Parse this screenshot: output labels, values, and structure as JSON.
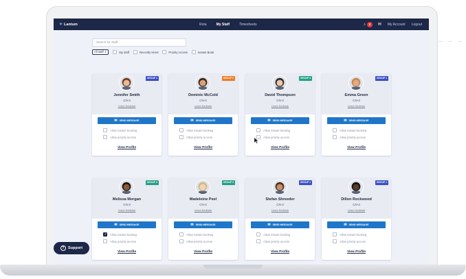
{
  "nav": {
    "logo": "Lantum",
    "links": [
      "Rota",
      "My Staff",
      "Timesheets"
    ],
    "notifications_count": "3",
    "my_account": "My Account",
    "logout": "Logout"
  },
  "search": {
    "placeholder": "Search for Staff"
  },
  "filters": {
    "selected": "All staff",
    "options": [
      "My staff",
      "Recently Hired",
      "Priority Access",
      "Instant Book"
    ]
  },
  "card_labels": {
    "leave_feedback": "Leave feedback",
    "send_message": "SEND MESSAGE",
    "allow_instant": "Allow instant booking",
    "allow_priority": "Allow priority access",
    "view_profile": "View Profile"
  },
  "staff": [
    {
      "name": "Jennifer Smith",
      "grade": "CN-3",
      "group": "GROUP 1",
      "group_color": "#3b4fc4",
      "instant_checked": false
    },
    {
      "name": "Dominic McCold",
      "grade": "CN-3",
      "group": "GROUP 2",
      "group_color": "#f07a22",
      "instant_checked": false
    },
    {
      "name": "David Thompson",
      "grade": "CN-3",
      "group": "GROUP 3",
      "group_color": "#23a086",
      "instant_checked": false
    },
    {
      "name": "Emma Green",
      "grade": "CN-3",
      "group": "GROUP 1",
      "group_color": "#3b4fc4",
      "instant_checked": false
    },
    {
      "name": "Melissa Morgan",
      "grade": "CN-3",
      "group": "GROUP 3",
      "group_color": "#23a086",
      "instant_checked": true
    },
    {
      "name": "Madeleine Peel",
      "grade": "CN-3",
      "group": "GROUP 3",
      "group_color": "#23a086",
      "instant_checked": false
    },
    {
      "name": "Stefan Shreeder",
      "grade": "CN-3",
      "group": "GROUP 1",
      "group_color": "#3b4fc4",
      "instant_checked": false
    },
    {
      "name": "Dillon Rockwood",
      "grade": "CN-3",
      "group": "GROUP 1",
      "group_color": "#3b4fc4",
      "instant_checked": false
    }
  ],
  "support": {
    "label": "Support"
  },
  "icons": {
    "logo": "lantum-logo-icon",
    "bell": "bell-icon",
    "mail": "envelope-icon",
    "support": "question-circle-icon"
  },
  "colors": {
    "navbar": "#1d2747",
    "primary_button": "#1f76c9",
    "background": "#eef1f8"
  }
}
